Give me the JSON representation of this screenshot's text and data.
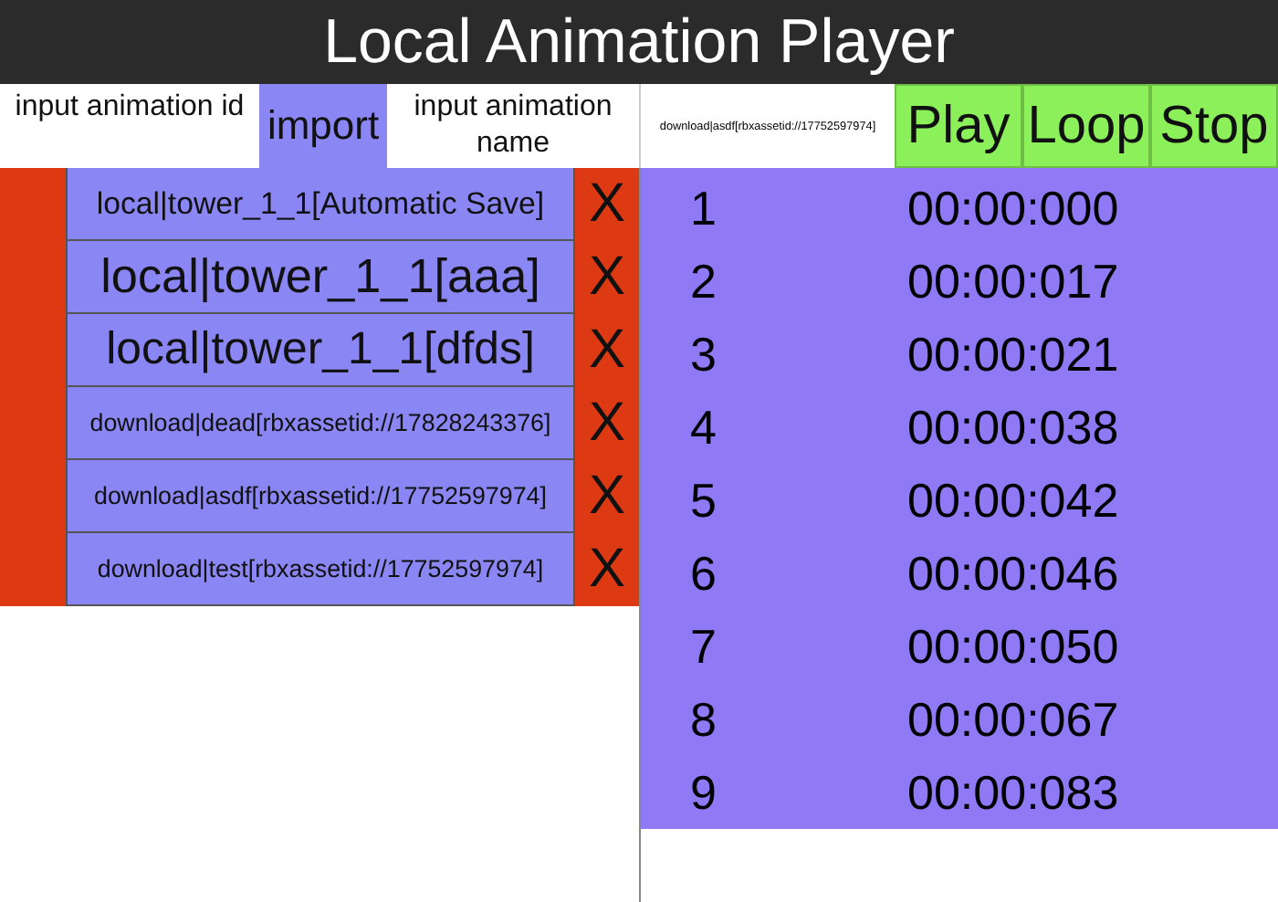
{
  "window": {
    "title": "Local Animation Player"
  },
  "toolbar": {
    "id_field": {
      "placeholder": "input animation id"
    },
    "import_button": "import",
    "name_field": {
      "placeholder": "input animation name"
    },
    "current_animation": "download|asdf[rbxassetid://17752597974]",
    "buttons": [
      "Play",
      "Loop",
      "Stop"
    ]
  },
  "animations": [
    {
      "name": "local|tower_1_1[Automatic Save]",
      "delete": "X"
    },
    {
      "name": "local|tower_1_1[aaa]",
      "delete": "X"
    },
    {
      "name": "local|tower_1_1[dfds]",
      "delete": "X"
    },
    {
      "name": "download|dead[rbxassetid://17828243376]",
      "delete": "X"
    },
    {
      "name": "download|asdf[rbxassetid://17752597974]",
      "delete": "X"
    },
    {
      "name": "download|test[rbxassetid://17752597974]",
      "delete": "X"
    }
  ],
  "keyframes": [
    {
      "index": "1",
      "time": "00:00:000"
    },
    {
      "index": "2",
      "time": "00:00:017"
    },
    {
      "index": "3",
      "time": "00:00:021"
    },
    {
      "index": "4",
      "time": "00:00:038"
    },
    {
      "index": "5",
      "time": "00:00:042"
    },
    {
      "index": "6",
      "time": "00:00:046"
    },
    {
      "index": "7",
      "time": "00:00:050"
    },
    {
      "index": "8",
      "time": "00:00:067"
    },
    {
      "index": "9",
      "time": "00:00:083"
    }
  ]
}
